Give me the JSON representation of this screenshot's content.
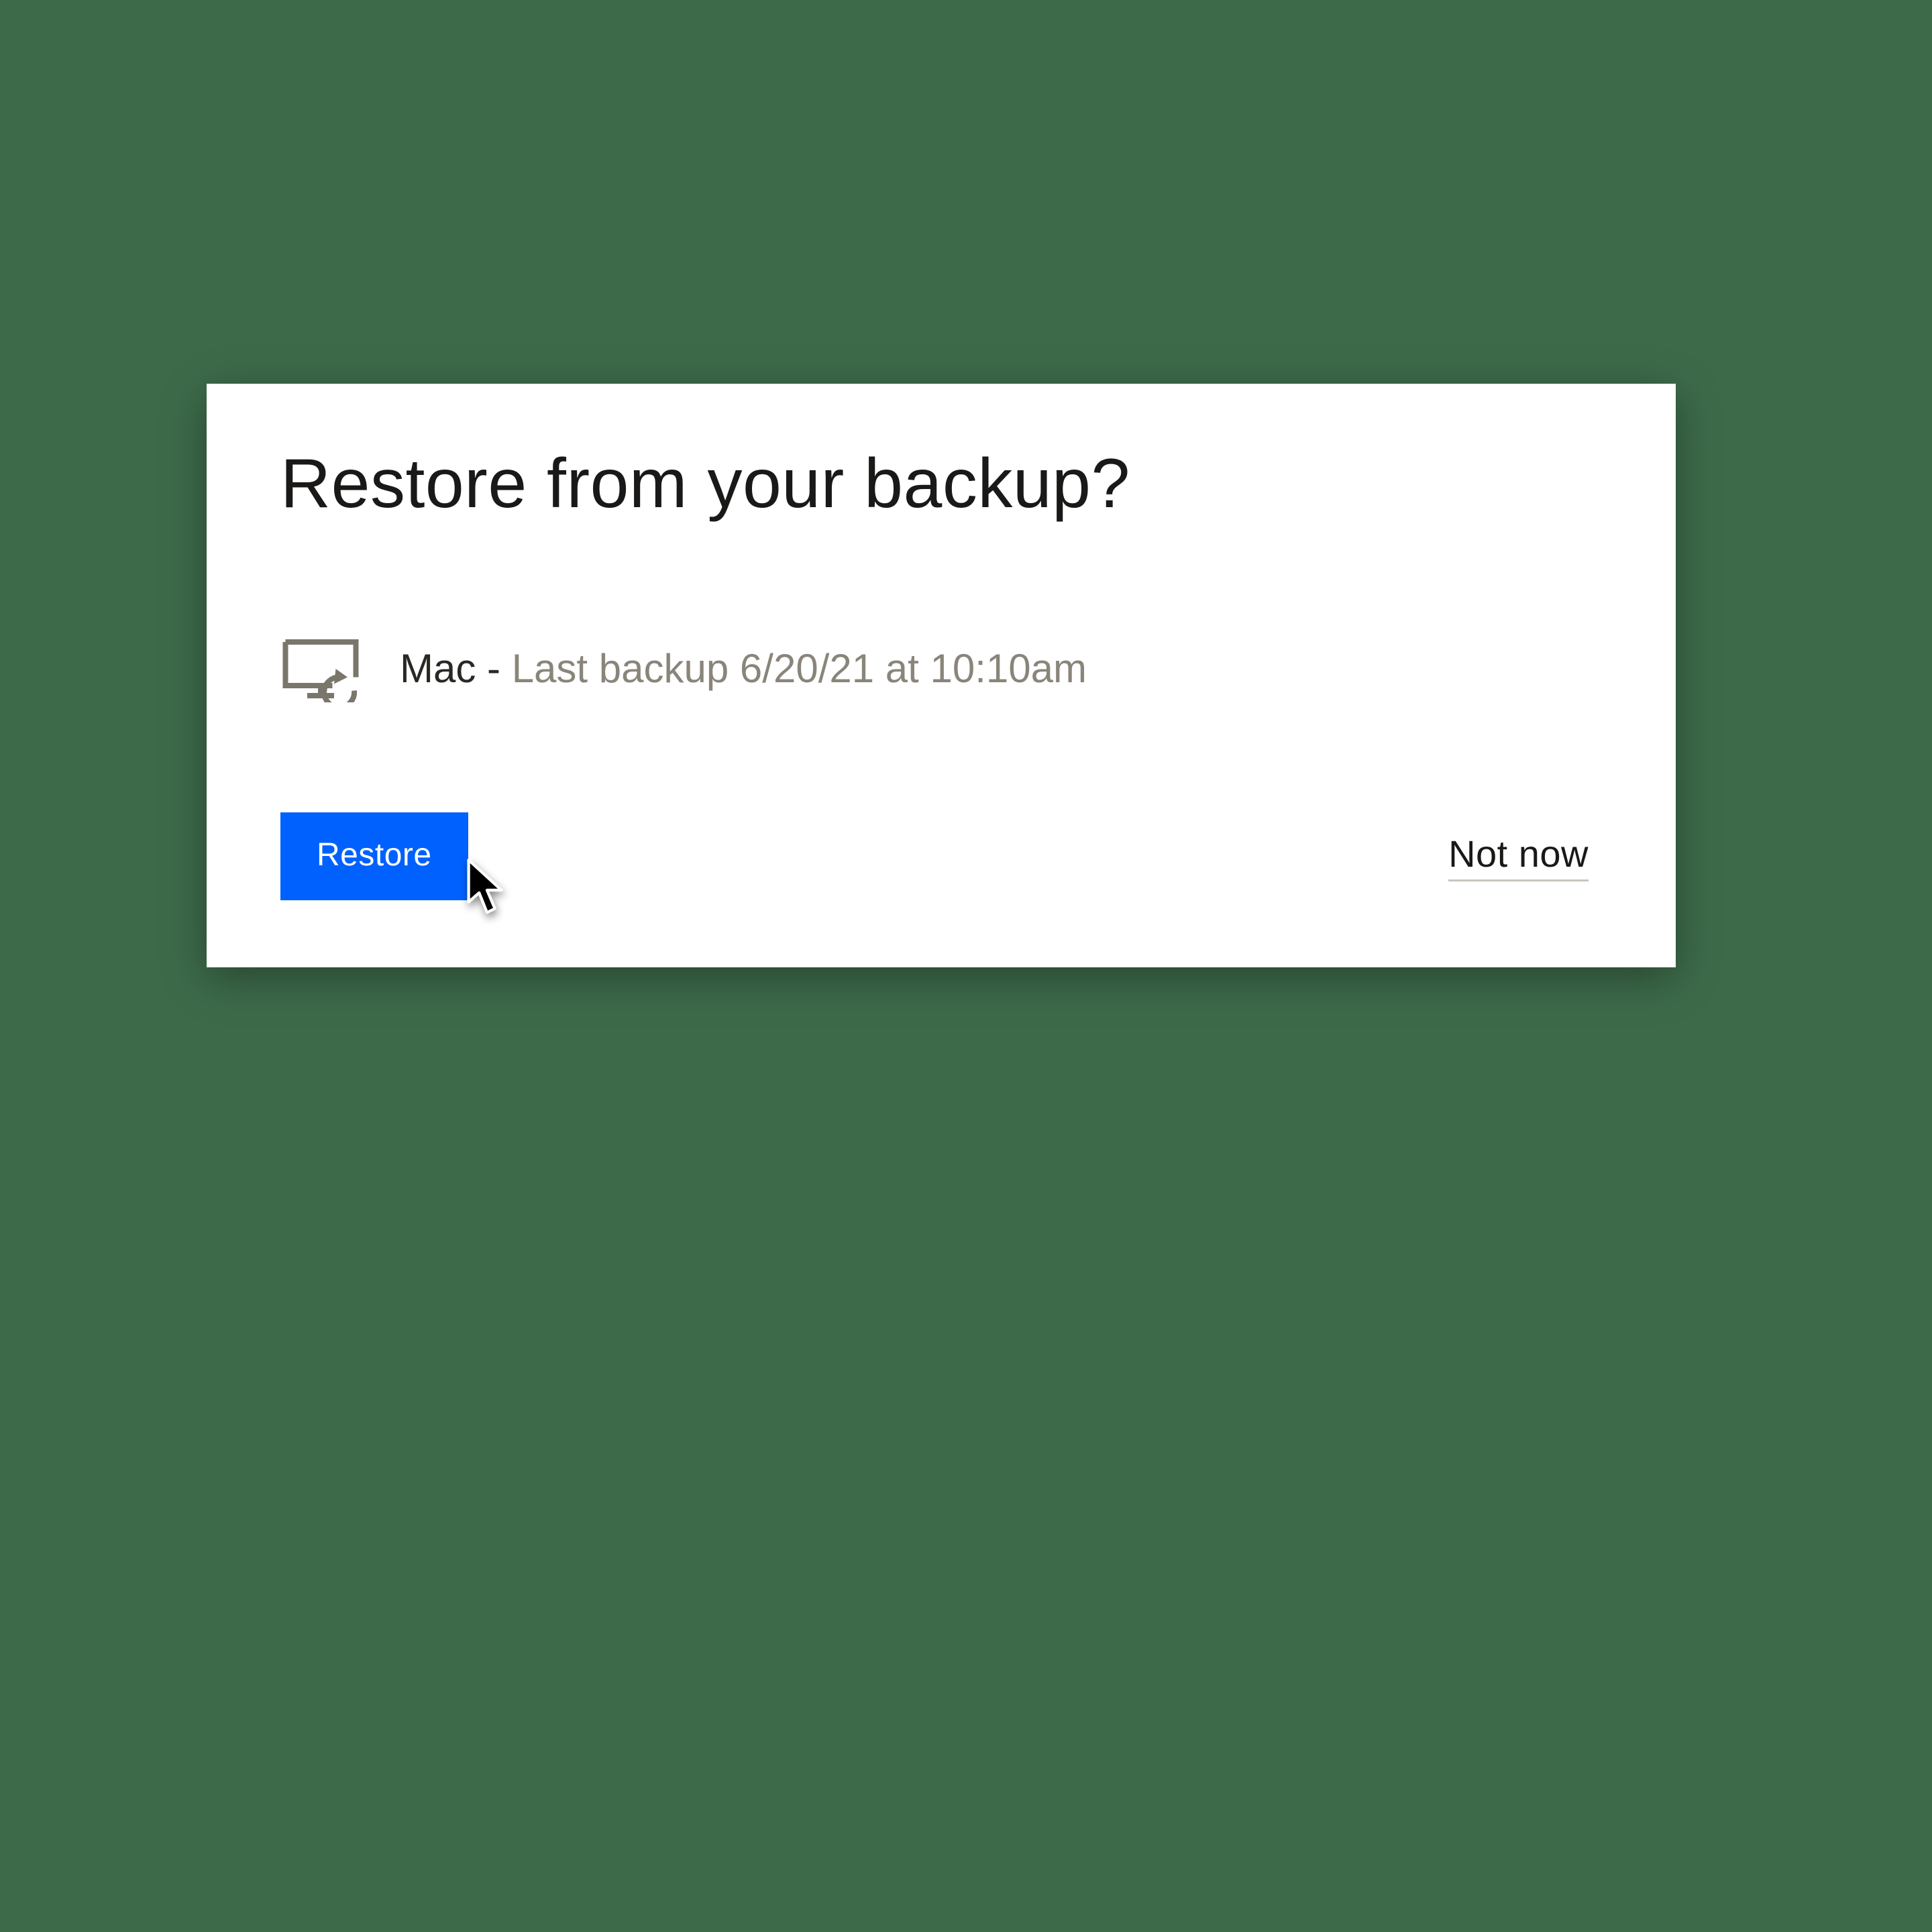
{
  "dialog": {
    "title": "Restore from your backup?",
    "device": {
      "name": "Mac",
      "separator": " - ",
      "meta": "Last backup 6/20/21 at 10:10am"
    },
    "actions": {
      "primary": "Restore",
      "secondary": "Not now"
    }
  }
}
